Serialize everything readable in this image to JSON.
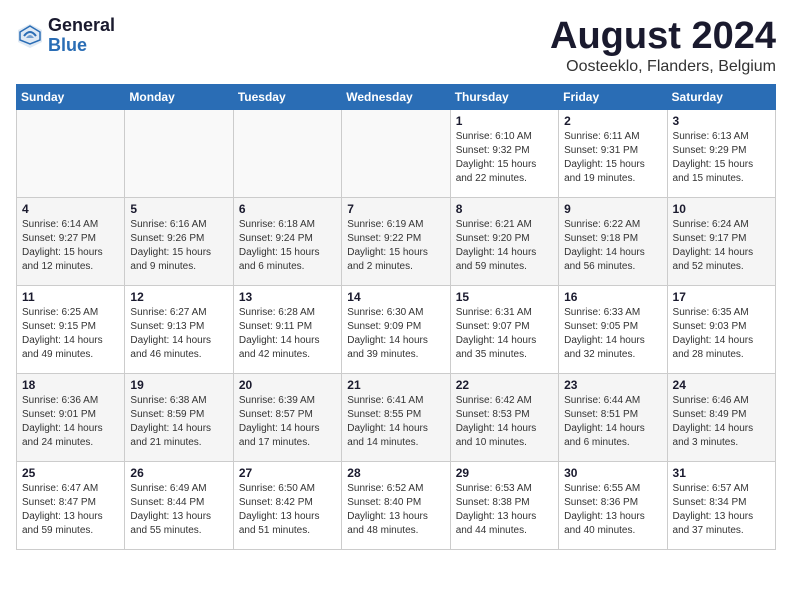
{
  "header": {
    "logo_general": "General",
    "logo_blue": "Blue",
    "month_title": "August 2024",
    "location": "Oosteeklo, Flanders, Belgium"
  },
  "calendar": {
    "weekdays": [
      "Sunday",
      "Monday",
      "Tuesday",
      "Wednesday",
      "Thursday",
      "Friday",
      "Saturday"
    ],
    "weeks": [
      [
        {
          "day": "",
          "info": ""
        },
        {
          "day": "",
          "info": ""
        },
        {
          "day": "",
          "info": ""
        },
        {
          "day": "",
          "info": ""
        },
        {
          "day": "1",
          "info": "Sunrise: 6:10 AM\nSunset: 9:32 PM\nDaylight: 15 hours\nand 22 minutes."
        },
        {
          "day": "2",
          "info": "Sunrise: 6:11 AM\nSunset: 9:31 PM\nDaylight: 15 hours\nand 19 minutes."
        },
        {
          "day": "3",
          "info": "Sunrise: 6:13 AM\nSunset: 9:29 PM\nDaylight: 15 hours\nand 15 minutes."
        }
      ],
      [
        {
          "day": "4",
          "info": "Sunrise: 6:14 AM\nSunset: 9:27 PM\nDaylight: 15 hours\nand 12 minutes."
        },
        {
          "day": "5",
          "info": "Sunrise: 6:16 AM\nSunset: 9:26 PM\nDaylight: 15 hours\nand 9 minutes."
        },
        {
          "day": "6",
          "info": "Sunrise: 6:18 AM\nSunset: 9:24 PM\nDaylight: 15 hours\nand 6 minutes."
        },
        {
          "day": "7",
          "info": "Sunrise: 6:19 AM\nSunset: 9:22 PM\nDaylight: 15 hours\nand 2 minutes."
        },
        {
          "day": "8",
          "info": "Sunrise: 6:21 AM\nSunset: 9:20 PM\nDaylight: 14 hours\nand 59 minutes."
        },
        {
          "day": "9",
          "info": "Sunrise: 6:22 AM\nSunset: 9:18 PM\nDaylight: 14 hours\nand 56 minutes."
        },
        {
          "day": "10",
          "info": "Sunrise: 6:24 AM\nSunset: 9:17 PM\nDaylight: 14 hours\nand 52 minutes."
        }
      ],
      [
        {
          "day": "11",
          "info": "Sunrise: 6:25 AM\nSunset: 9:15 PM\nDaylight: 14 hours\nand 49 minutes."
        },
        {
          "day": "12",
          "info": "Sunrise: 6:27 AM\nSunset: 9:13 PM\nDaylight: 14 hours\nand 46 minutes."
        },
        {
          "day": "13",
          "info": "Sunrise: 6:28 AM\nSunset: 9:11 PM\nDaylight: 14 hours\nand 42 minutes."
        },
        {
          "day": "14",
          "info": "Sunrise: 6:30 AM\nSunset: 9:09 PM\nDaylight: 14 hours\nand 39 minutes."
        },
        {
          "day": "15",
          "info": "Sunrise: 6:31 AM\nSunset: 9:07 PM\nDaylight: 14 hours\nand 35 minutes."
        },
        {
          "day": "16",
          "info": "Sunrise: 6:33 AM\nSunset: 9:05 PM\nDaylight: 14 hours\nand 32 minutes."
        },
        {
          "day": "17",
          "info": "Sunrise: 6:35 AM\nSunset: 9:03 PM\nDaylight: 14 hours\nand 28 minutes."
        }
      ],
      [
        {
          "day": "18",
          "info": "Sunrise: 6:36 AM\nSunset: 9:01 PM\nDaylight: 14 hours\nand 24 minutes."
        },
        {
          "day": "19",
          "info": "Sunrise: 6:38 AM\nSunset: 8:59 PM\nDaylight: 14 hours\nand 21 minutes."
        },
        {
          "day": "20",
          "info": "Sunrise: 6:39 AM\nSunset: 8:57 PM\nDaylight: 14 hours\nand 17 minutes."
        },
        {
          "day": "21",
          "info": "Sunrise: 6:41 AM\nSunset: 8:55 PM\nDaylight: 14 hours\nand 14 minutes."
        },
        {
          "day": "22",
          "info": "Sunrise: 6:42 AM\nSunset: 8:53 PM\nDaylight: 14 hours\nand 10 minutes."
        },
        {
          "day": "23",
          "info": "Sunrise: 6:44 AM\nSunset: 8:51 PM\nDaylight: 14 hours\nand 6 minutes."
        },
        {
          "day": "24",
          "info": "Sunrise: 6:46 AM\nSunset: 8:49 PM\nDaylight: 14 hours\nand 3 minutes."
        }
      ],
      [
        {
          "day": "25",
          "info": "Sunrise: 6:47 AM\nSunset: 8:47 PM\nDaylight: 13 hours\nand 59 minutes."
        },
        {
          "day": "26",
          "info": "Sunrise: 6:49 AM\nSunset: 8:44 PM\nDaylight: 13 hours\nand 55 minutes."
        },
        {
          "day": "27",
          "info": "Sunrise: 6:50 AM\nSunset: 8:42 PM\nDaylight: 13 hours\nand 51 minutes."
        },
        {
          "day": "28",
          "info": "Sunrise: 6:52 AM\nSunset: 8:40 PM\nDaylight: 13 hours\nand 48 minutes."
        },
        {
          "day": "29",
          "info": "Sunrise: 6:53 AM\nSunset: 8:38 PM\nDaylight: 13 hours\nand 44 minutes."
        },
        {
          "day": "30",
          "info": "Sunrise: 6:55 AM\nSunset: 8:36 PM\nDaylight: 13 hours\nand 40 minutes."
        },
        {
          "day": "31",
          "info": "Sunrise: 6:57 AM\nSunset: 8:34 PM\nDaylight: 13 hours\nand 37 minutes."
        }
      ]
    ]
  }
}
